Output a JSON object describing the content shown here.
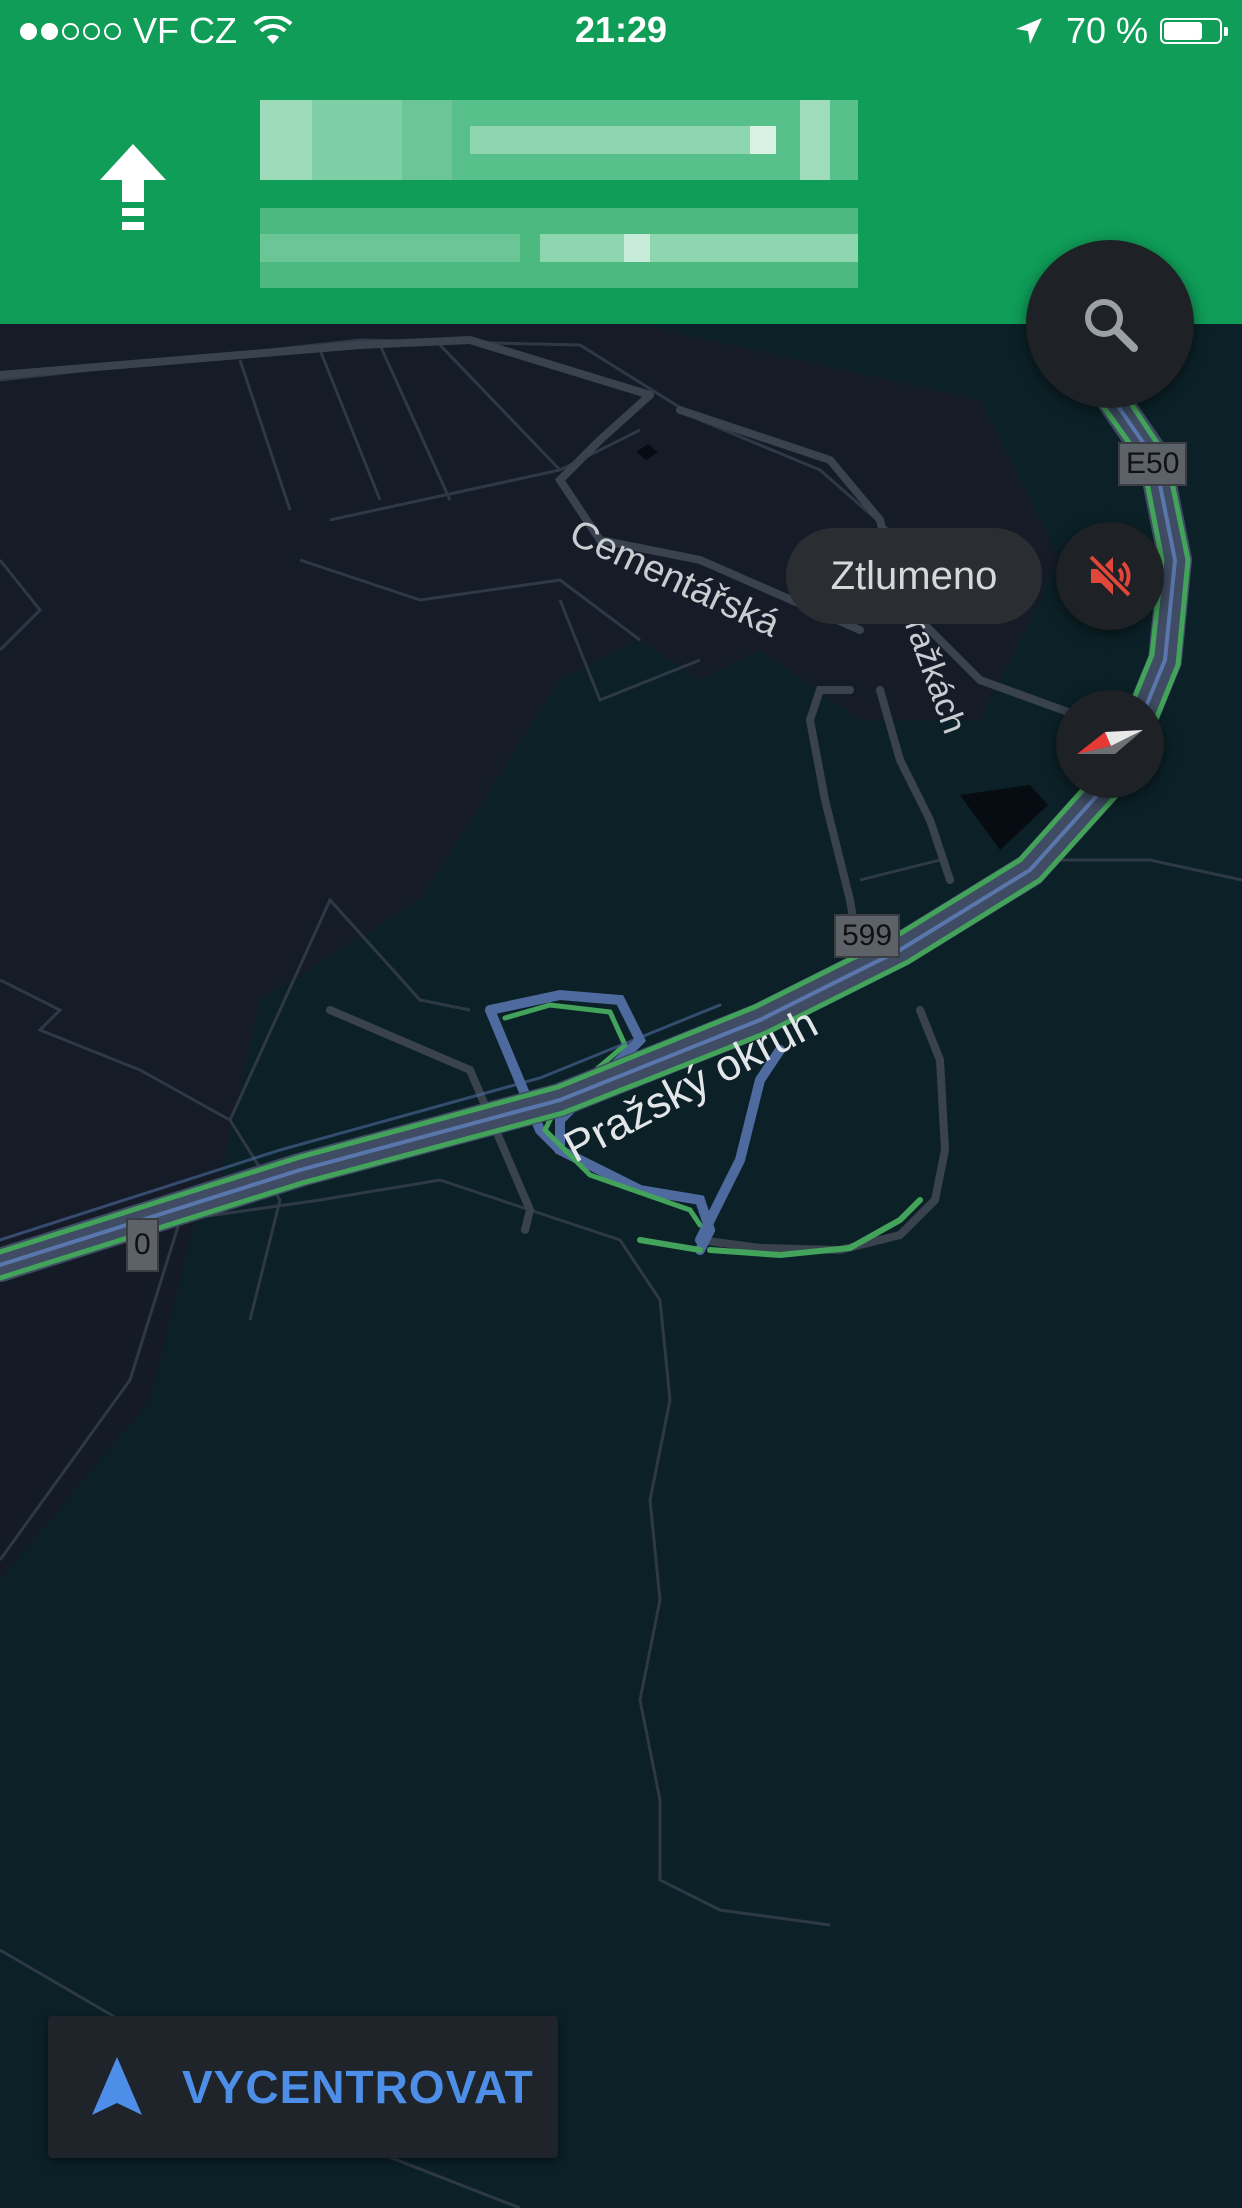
{
  "status_bar": {
    "carrier": "VF CZ",
    "signal_dots_filled": 2,
    "signal_dots_total": 5,
    "time": "21:29",
    "battery_text": "70 %",
    "battery_level": 0.7
  },
  "navigation": {
    "direction_icon": "arrow-straight-icon",
    "street_name": "",
    "next_step": ""
  },
  "map": {
    "labels": {
      "cementarska": "Cementářská",
      "na_drazkach": "Na Dražkách",
      "prazsky_okruh": "Pražský okruh"
    },
    "shields": {
      "e50": "E50",
      "r599": "599",
      "r0": "0"
    },
    "colors": {
      "background_dark": "#0b2127",
      "land_dark": "#151c28",
      "road": "#3a424e",
      "route_blue": "#4f6a9e",
      "traffic_green": "#43a35a",
      "header_green": "#0f9d58"
    }
  },
  "controls": {
    "search_icon": "search-icon",
    "mute_label": "Ztlumeno",
    "mute_icon": "volume-off-icon",
    "compass_icon": "compass-icon",
    "recenter_label": "VYCENTROVAT",
    "recenter_icon": "navigation-arrow-icon",
    "accent_blue": "#4d8fe8",
    "mute_red": "#e0463a"
  }
}
